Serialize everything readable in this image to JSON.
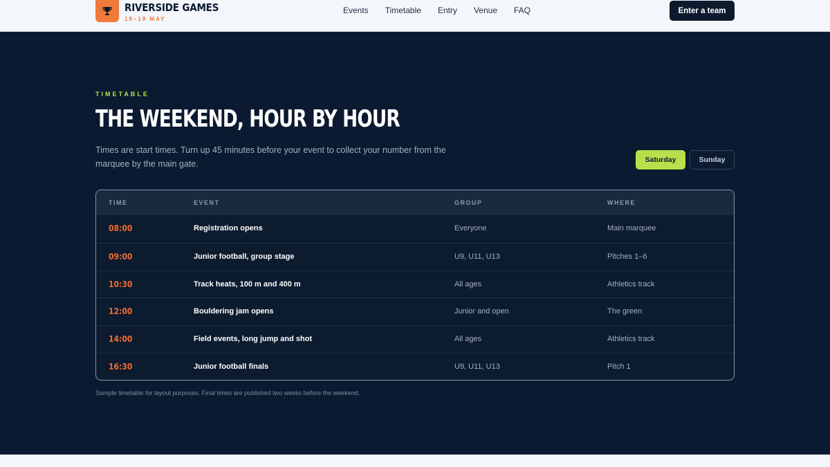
{
  "header": {
    "brand_name": "RIVERSIDE GAMES",
    "brand_dates": "18–19 MAY",
    "logo_icon": "trophy-icon",
    "nav": [
      "Events",
      "Timetable",
      "Entry",
      "Venue",
      "FAQ"
    ],
    "cta_label": "Enter a team"
  },
  "hero": {
    "eyebrow": "TIMETABLE",
    "title": "THE WEEKEND, HOUR BY HOUR",
    "intro": "Times are start times. Turn up 45 minutes before your event to collect your number from the marquee by the main gate."
  },
  "day_toggle": {
    "options": [
      "Saturday",
      "Sunday"
    ],
    "selected": "Saturday"
  },
  "table": {
    "columns": [
      "TIME",
      "EVENT",
      "GROUP",
      "WHERE"
    ],
    "rows": [
      {
        "time": "08:00",
        "event": "Registration opens",
        "group": "Everyone",
        "where": "Main marquee"
      },
      {
        "time": "09:00",
        "event": "Junior football, group stage",
        "group": "U9, U11, U13",
        "where": "Pitches 1–6"
      },
      {
        "time": "10:30",
        "event": "Track heats, 100 m and 400 m",
        "group": "All ages",
        "where": "Athletics track"
      },
      {
        "time": "12:00",
        "event": "Bouldering jam opens",
        "group": "Junior and open",
        "where": "The green"
      },
      {
        "time": "14:00",
        "event": "Field events, long jump and shot",
        "group": "All ages",
        "where": "Athletics track"
      },
      {
        "time": "16:30",
        "event": "Junior football finals",
        "group": "U9, U11, U13",
        "where": "Pitch 1"
      }
    ]
  },
  "footnote": "Sample timetable for layout purposes. Final times are published two weeks before the weekend.",
  "colors": {
    "background": "#0b1a30",
    "accent_orange": "#f07a3a",
    "accent_lime": "#b7e04b",
    "header_bg": "#f3f6fa"
  }
}
